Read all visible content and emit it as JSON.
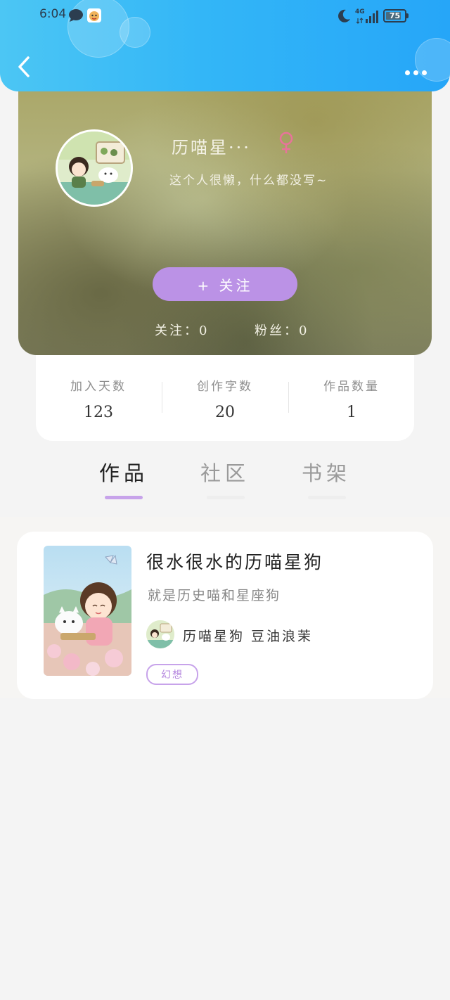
{
  "status_bar": {
    "time": "6:04",
    "network": "4G",
    "battery": "75"
  },
  "nav": {
    "back_icon": "chevron-left-icon",
    "more_icon": "more-dots-icon"
  },
  "profile": {
    "username": "历喵星···",
    "gender_icon": "female-icon",
    "bio": "这个人很懒，什么都没写~",
    "follow_button": "+ 关注",
    "following_label": "关注：0",
    "fans_label": "粉丝：0"
  },
  "stats": [
    {
      "label": "加入天数",
      "value": "123"
    },
    {
      "label": "创作字数",
      "value": "20"
    },
    {
      "label": "作品数量",
      "value": "1"
    }
  ],
  "tabs": [
    {
      "label": "作品",
      "active": true
    },
    {
      "label": "社区",
      "active": false
    },
    {
      "label": "书架",
      "active": false
    }
  ],
  "works": [
    {
      "title": "很水很水的历喵星狗",
      "description": "就是历史喵和星座狗",
      "author": "历喵星狗 豆油浪茉",
      "tag": "幻想"
    }
  ],
  "colors": {
    "header_blue": "#33b6f7",
    "accent_purple": "#bb92e6",
    "female_pink": "#e8739a"
  }
}
